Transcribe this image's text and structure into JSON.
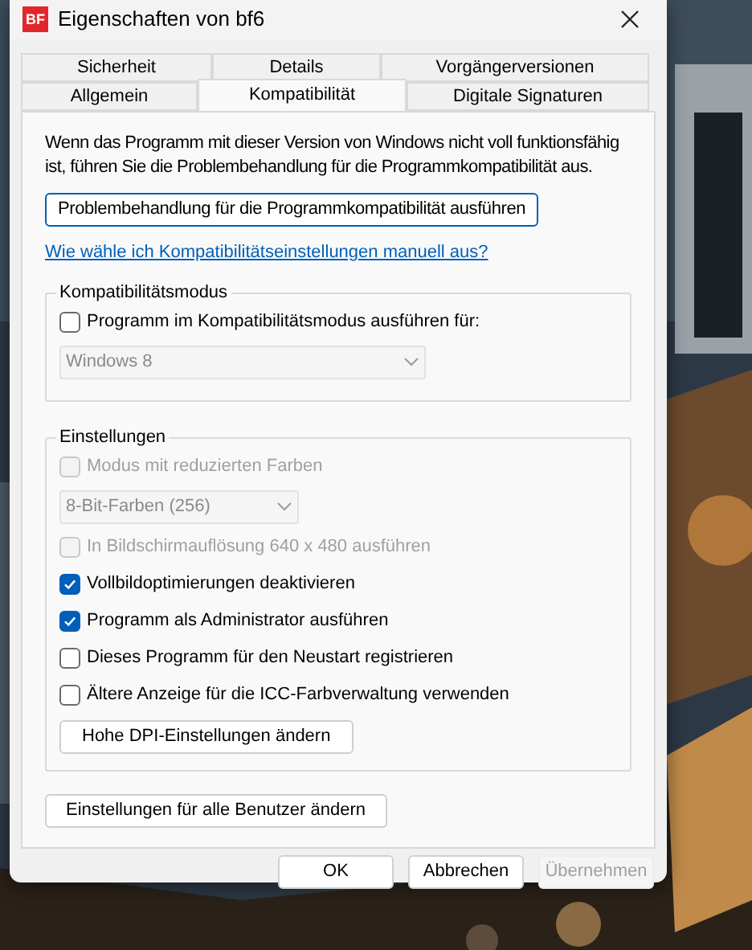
{
  "window": {
    "title": "Eigenschaften von bf6",
    "app_icon_text": "BF"
  },
  "tab_rows": [
    {
      "tabs": [
        {
          "label": "Sicherheit",
          "selected": false
        },
        {
          "label": "Details",
          "selected": false
        },
        {
          "label": "Vorgängerversionen",
          "selected": false
        }
      ]
    },
    {
      "tabs": [
        {
          "label": "Allgemein",
          "selected": false
        },
        {
          "label": "Kompatibilität",
          "selected": true
        },
        {
          "label": "Digitale Signaturen",
          "selected": false
        }
      ]
    }
  ],
  "description": "Wenn das Programm mit dieser Version von Windows nicht voll funktionsfähig ist, führen Sie die Problembehandlung für die Programmkompatibilität aus.",
  "troubleshoot_button": "Problembehandlung für die Programmkompatibilität ausführen",
  "help_link": "Wie wähle ich Kompatibilitätseinstellungen manuell aus?",
  "compat_group": {
    "title": "Kompatibilitätsmodus",
    "items": [
      {
        "kind": "checkbox",
        "label": "Programm im Kompatibilitätsmodus ausführen für:",
        "checked": false,
        "disabled": false
      },
      {
        "kind": "dropdown",
        "value": "Windows 8",
        "disabled": true
      }
    ]
  },
  "settings_group": {
    "title": "Einstellungen",
    "items": [
      {
        "kind": "checkbox",
        "label": "Modus mit reduzierten Farben",
        "checked": false,
        "disabled": true
      },
      {
        "kind": "dropdown",
        "value": "8-Bit-Farben (256)",
        "disabled": true
      },
      {
        "kind": "checkbox",
        "label": "In Bildschirmauflösung 640 x 480 ausführen",
        "checked": false,
        "disabled": true
      },
      {
        "kind": "checkbox",
        "label": "Vollbildoptimierungen deaktivieren",
        "checked": true,
        "disabled": false
      },
      {
        "kind": "checkbox",
        "label": "Programm als Administrator ausführen",
        "checked": true,
        "disabled": false
      },
      {
        "kind": "checkbox",
        "label": "Dieses Programm für den Neustart registrieren",
        "checked": false,
        "disabled": false
      },
      {
        "kind": "checkbox",
        "label": "Ältere Anzeige für die ICC-Farbverwaltung verwenden",
        "checked": false,
        "disabled": false
      },
      {
        "kind": "button",
        "label": "Hohe DPI-Einstellungen ändern",
        "disabled": false
      }
    ]
  },
  "all_users_button": "Einstellungen für alle Benutzer ändern",
  "footer_buttons": [
    {
      "label": "OK",
      "disabled": false
    },
    {
      "label": "Abbrechen",
      "disabled": false
    },
    {
      "label": "Übernehmen",
      "disabled": true
    }
  ]
}
